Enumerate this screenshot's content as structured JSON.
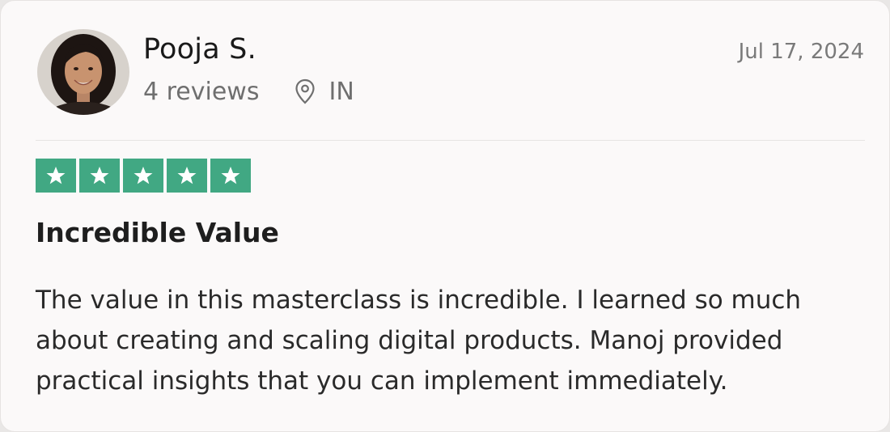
{
  "review": {
    "author": {
      "name": "Pooja S.",
      "reviews_count": "4 reviews",
      "location": "IN",
      "avatar_icon": "avatar-photo"
    },
    "date": "Jul 17, 2024",
    "rating": {
      "value": 5,
      "max": 5,
      "color": "#41a883"
    },
    "title": "Incredible Value",
    "text": "The value in this masterclass is incredible. I learned so much about creating and scaling digital products. Manoj provided practical insights that you can implement immediately."
  }
}
